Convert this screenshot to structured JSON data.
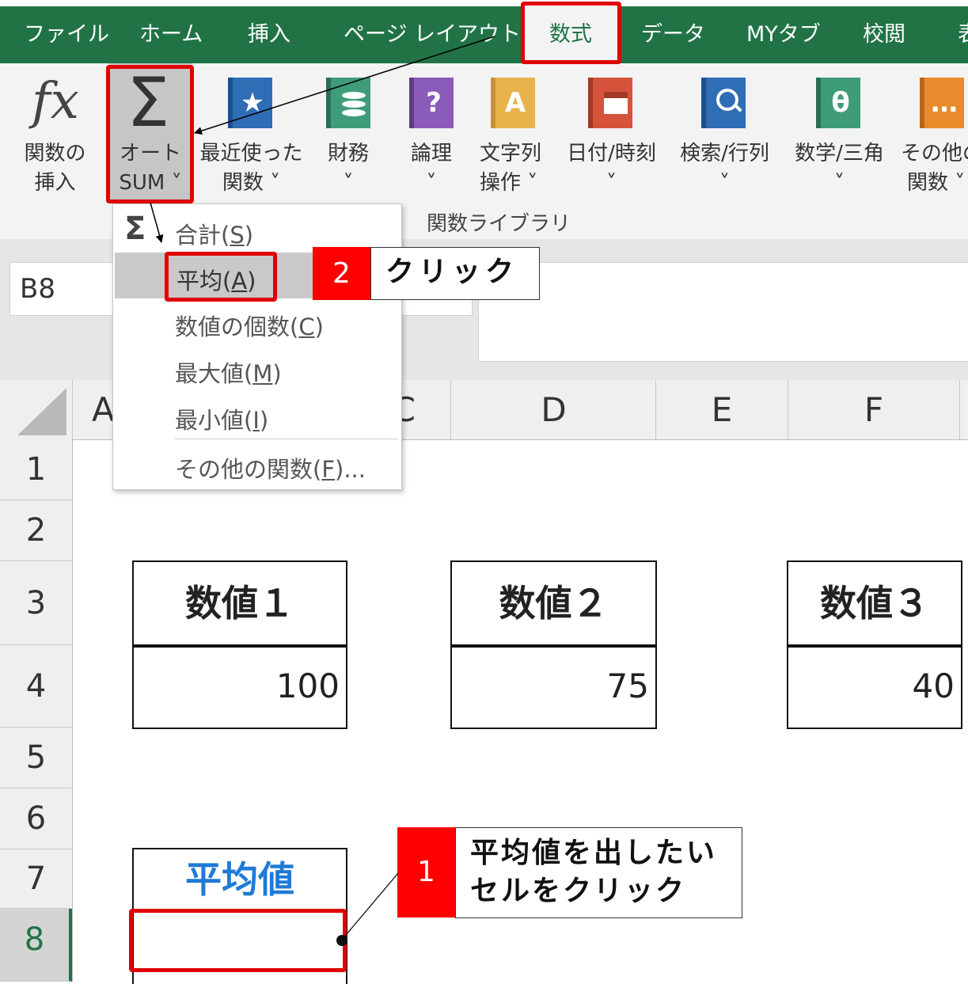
{
  "tabs": [
    {
      "label": "ファイル",
      "active": false
    },
    {
      "label": "ホーム",
      "active": false
    },
    {
      "label": "挿入",
      "active": false
    },
    {
      "label": "ページ レイアウト",
      "active": false
    },
    {
      "label": "数式",
      "active": true
    },
    {
      "label": "データ",
      "active": false
    },
    {
      "label": "MYタブ",
      "active": false
    },
    {
      "label": "校閲",
      "active": false
    },
    {
      "label": "表",
      "active": false
    }
  ],
  "ribbon": {
    "insert_function": {
      "line1": "関数の",
      "line2": "挿入",
      "icon": "fx"
    },
    "autosum": {
      "line1": "オート",
      "line2": "SUM ˅",
      "icon": "Σ"
    },
    "buttons": [
      {
        "line1": "最近使った",
        "line2": "関数 ˅",
        "icon": "star-icon",
        "color": "#2f6db5"
      },
      {
        "line1": "財務",
        "line2": "˅",
        "icon": "coins-icon",
        "color": "#3f9c78"
      },
      {
        "line1": "論理",
        "line2": "˅",
        "icon": "question-icon",
        "color": "#8a5bb8"
      },
      {
        "line1": "文字列",
        "line2": "操作 ˅",
        "icon": "letter-a-icon",
        "color": "#e8b34a"
      },
      {
        "line1": "日付/時刻",
        "line2": "˅",
        "icon": "calendar-icon",
        "color": "#d5533b"
      },
      {
        "line1": "検索/行列",
        "line2": "˅",
        "icon": "search-icon",
        "color": "#2f6db5"
      },
      {
        "line1": "数学/三角",
        "line2": "˅",
        "icon": "theta-icon",
        "color": "#3f9c78"
      },
      {
        "line1": "その他の",
        "line2": "関数 ˅",
        "icon": "more-icon",
        "color": "#e98a2c"
      }
    ],
    "group_label": "関数ライブラリ",
    "icon_glyphs": {
      "star": "★",
      "question": "?",
      "letter_a": "A",
      "search": "⚲",
      "theta": "θ",
      "more": "…"
    }
  },
  "name_box": "B8",
  "columns": [
    "A",
    "C",
    "D",
    "E",
    "F"
  ],
  "rows": [
    "1",
    "2",
    "3",
    "4",
    "5",
    "6",
    "7",
    "8"
  ],
  "dropdown": {
    "sigma": "Σ",
    "items": [
      {
        "text": "合計(",
        "key": "S",
        "tail": ")"
      },
      {
        "text": "平均(",
        "key": "A",
        "tail": ")"
      },
      {
        "text": "数値の個数(",
        "key": "C",
        "tail": ")"
      },
      {
        "text": "最大値(",
        "key": "M",
        "tail": ")"
      },
      {
        "text": "最小値(",
        "key": "I",
        "tail": ")"
      },
      {
        "text": "その他の関数(",
        "key": "F",
        "tail": ")..."
      }
    ]
  },
  "value_boxes": [
    {
      "header": "数値１",
      "value": "100"
    },
    {
      "header": "数値２",
      "value": "75"
    },
    {
      "header": "数値３",
      "value": "40"
    }
  ],
  "average": {
    "header": "平均値",
    "color": "#1f7ad6"
  },
  "callouts": {
    "step1": {
      "number": "1",
      "text_line1": "平均値を出したい",
      "text_line2": "セルをクリック"
    },
    "step2": {
      "number": "2",
      "text": "クリック"
    }
  },
  "colors": {
    "excel_green": "#217346",
    "highlight_red": "#e00000",
    "callout_red": "#ff0000"
  }
}
